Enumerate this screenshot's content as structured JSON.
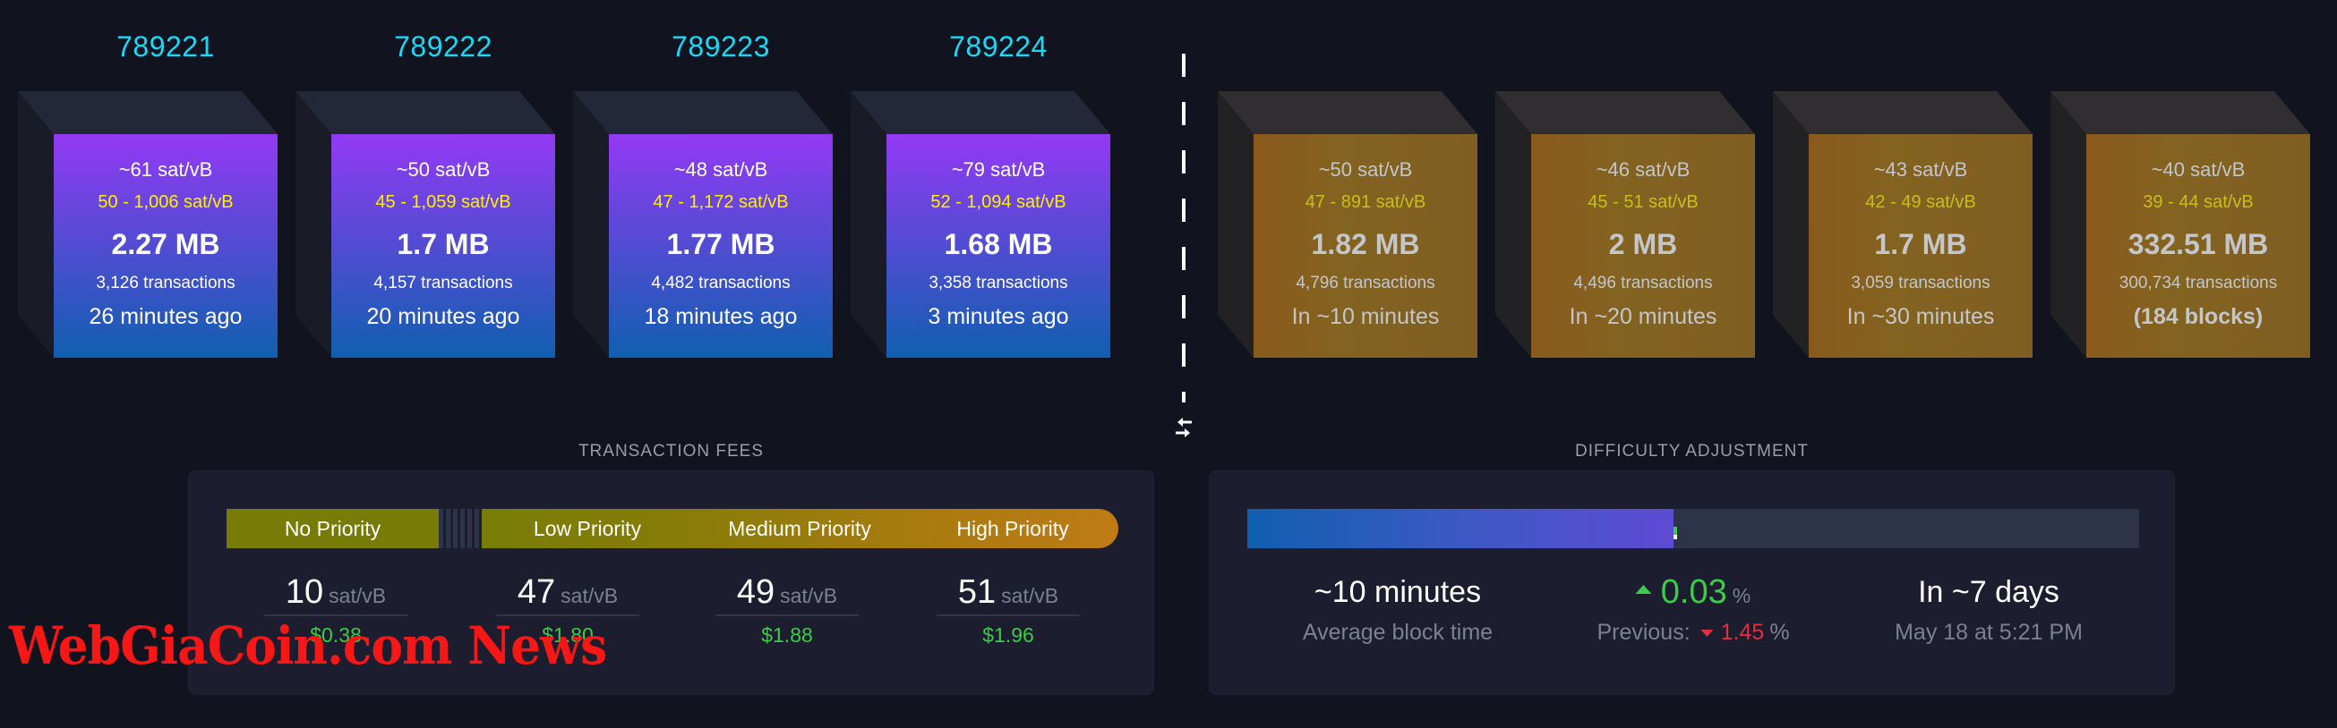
{
  "mined_blocks": [
    {
      "height": "789221",
      "median_fee": "~61 sat/vB",
      "fee_range": "50 - 1,006 sat/vB",
      "size": "2.27 MB",
      "tx_count": "3,126 transactions",
      "time": "26 minutes ago"
    },
    {
      "height": "789222",
      "median_fee": "~50 sat/vB",
      "fee_range": "45 - 1,059 sat/vB",
      "size": "1.7 MB",
      "tx_count": "4,157 transactions",
      "time": "20 minutes ago"
    },
    {
      "height": "789223",
      "median_fee": "~48 sat/vB",
      "fee_range": "47 - 1,172 sat/vB",
      "size": "1.77 MB",
      "tx_count": "4,482 transactions",
      "time": "18 minutes ago"
    },
    {
      "height": "789224",
      "median_fee": "~79 sat/vB",
      "fee_range": "52 - 1,094 sat/vB",
      "size": "1.68 MB",
      "tx_count": "3,358 transactions",
      "time": "3 minutes ago"
    }
  ],
  "mempool_blocks": [
    {
      "median_fee": "~50 sat/vB",
      "fee_range": "47 - 891 sat/vB",
      "size": "1.82 MB",
      "tx_count": "4,796 transactions",
      "eta": "In ~10 minutes"
    },
    {
      "median_fee": "~46 sat/vB",
      "fee_range": "45 - 51 sat/vB",
      "size": "2 MB",
      "tx_count": "4,496 transactions",
      "eta": "In ~20 minutes"
    },
    {
      "median_fee": "~43 sat/vB",
      "fee_range": "42 - 49 sat/vB",
      "size": "1.7 MB",
      "tx_count": "3,059 transactions",
      "eta": "In ~30 minutes"
    },
    {
      "median_fee": "~40 sat/vB",
      "fee_range": "39 - 44 sat/vB",
      "size": "332.51 MB",
      "tx_count": "300,734 transactions",
      "eta": "(184 blocks)"
    }
  ],
  "divider": {
    "swap_icon": "swap-arrows-icon"
  },
  "transaction_fees": {
    "title": "TRANSACTION FEES",
    "unit": "sat/vB",
    "tiers": [
      {
        "label": "No Priority",
        "rate": "10",
        "usd": "$0.38"
      },
      {
        "label": "Low Priority",
        "rate": "47",
        "usd": "$1.80"
      },
      {
        "label": "Medium Priority",
        "rate": "49",
        "usd": "$1.88"
      },
      {
        "label": "High Priority",
        "rate": "51",
        "usd": "$1.96"
      }
    ]
  },
  "difficulty_adjustment": {
    "title": "DIFFICULTY ADJUSTMENT",
    "progress_percent": 47.8,
    "avg_block_time": "~10 minutes",
    "avg_block_time_label": "Average block time",
    "change": "0.03",
    "change_unit": "%",
    "change_direction": "up",
    "previous_label": "Previous:",
    "previous_change": "1.45",
    "previous_direction": "down",
    "eta": "In ~7 days",
    "eta_date": "May 18 at 5:21 PM"
  },
  "watermark": "WebGiaCoin.com News",
  "colors": {
    "block_number": "#1bd8f4",
    "mined_gradient_top": "#9339f4",
    "mined_gradient_bottom": "#105fb0",
    "pending_face": "#836320",
    "fee_range_yellow": "#fff000",
    "usd_green": "#3bcc49",
    "negative_red": "#e0303f"
  }
}
